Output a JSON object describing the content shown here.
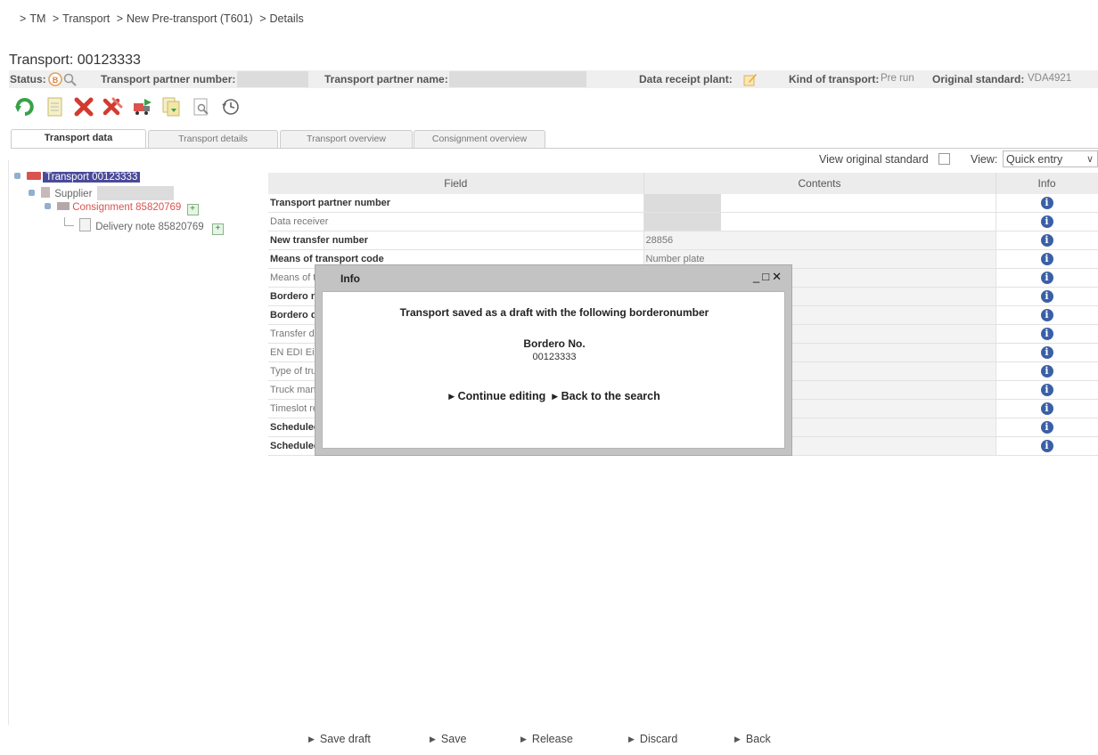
{
  "breadcrumb": {
    "items": [
      "TM",
      "Transport",
      "New Pre-transport (T601)",
      "Details"
    ]
  },
  "page": {
    "title": "Transport: 00123333"
  },
  "status_bar": {
    "status_label": "Status:",
    "partner_number_label": "Transport partner number:",
    "partner_name_label": "Transport partner name:",
    "data_receipt_label": "Data receipt plant:",
    "kind_label": "Kind of transport:",
    "kind_value": "Pre run",
    "standard_label": "Original standard:",
    "standard_value": "VDA4921"
  },
  "toolbar": {
    "icons": [
      "refresh-icon",
      "new-document-icon",
      "delete-icon",
      "delete-all-icon",
      "truck-forward-icon",
      "copy-document-icon",
      "preview-icon",
      "history-icon"
    ]
  },
  "tabs": [
    {
      "label": "Transport data",
      "active": true
    },
    {
      "label": "Transport details",
      "active": false
    },
    {
      "label": "Transport overview",
      "active": false
    },
    {
      "label": "Consignment overview",
      "active": false
    }
  ],
  "view": {
    "original_standard_label": "View original standard",
    "view_label": "View:",
    "selected": "Quick entry"
  },
  "tree": {
    "transport": "Transport 00123333",
    "supplier": "Supplier",
    "consignment": "Consignment 85820769",
    "delivery_note": "Delivery note 85820769"
  },
  "table": {
    "headers": [
      "Field",
      "Contents",
      "Info"
    ],
    "rows": [
      {
        "field": "Transport partner number",
        "bold": true,
        "contents": "",
        "masked": true
      },
      {
        "field": "Data receiver",
        "bold": false,
        "contents": "",
        "masked": true
      },
      {
        "field": "New transfer number",
        "bold": true,
        "contents": "28856",
        "masked": false
      },
      {
        "field": "Means of transport code",
        "bold": true,
        "contents": "Number plate",
        "masked": false
      },
      {
        "field": "Means of t",
        "bold": false,
        "contents": "",
        "masked": false
      },
      {
        "field": "Bordero n",
        "bold": true,
        "contents": "",
        "masked": false
      },
      {
        "field": "Bordero d",
        "bold": true,
        "contents": "",
        "masked": false
      },
      {
        "field": "Transfer da",
        "bold": false,
        "contents": "",
        "masked": false
      },
      {
        "field": "EN EDI Ei",
        "bold": false,
        "contents": "",
        "masked": false
      },
      {
        "field": "Type of tru",
        "bold": false,
        "contents": "",
        "masked": false
      },
      {
        "field": "Truck man",
        "bold": false,
        "contents": "",
        "masked": false
      },
      {
        "field": "Timeslot re",
        "bold": false,
        "contents": "",
        "masked": false
      },
      {
        "field": "Scheduled",
        "bold": true,
        "contents": "",
        "masked": false
      },
      {
        "field": "Scheduled",
        "bold": true,
        "contents": "",
        "masked": false
      }
    ]
  },
  "modal": {
    "title": "Info",
    "controls": "_ □ ✕",
    "message": "Transport saved as a draft with the following borderonumber",
    "bordero_label": "Bordero No.",
    "bordero_value": "00123333",
    "continue_label": "Continue editing",
    "back_search_label": "Back to the search"
  },
  "footer": {
    "save_draft": "Save draft",
    "save": "Save",
    "release": "Release",
    "discard": "Discard",
    "back": "Back"
  },
  "colors": {
    "selected_node": "#4a4a9a",
    "consignment_text": "#d9534f",
    "info_icon": "#3a5fa6",
    "modal_frame": "#c3c3c3"
  }
}
